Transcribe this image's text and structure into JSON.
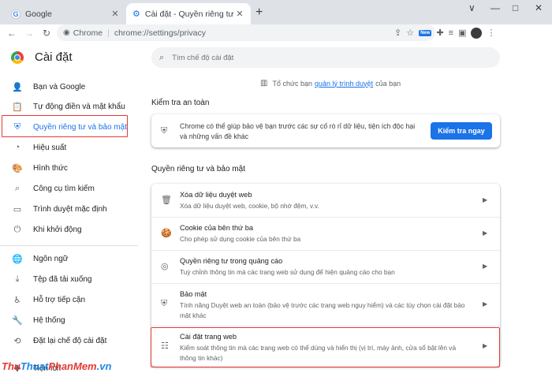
{
  "browser": {
    "tabs": [
      {
        "title": "Google",
        "icon": "google-g-icon",
        "close": "✕"
      },
      {
        "title": "Cài đặt - Quyền riêng tư và bảo mật",
        "icon": "gear-icon",
        "close": "✕"
      }
    ],
    "new_tab": "+",
    "window_controls": [
      "∨",
      "—",
      "□",
      "✕"
    ],
    "omnibox_chip": "Chrome",
    "omnibox_url": "chrome://settings/privacy",
    "extension_badge": "New"
  },
  "header": {
    "title": "Cài đặt",
    "search_placeholder": "Tìm chế độ cài đặt"
  },
  "sidebar": {
    "items": [
      {
        "label": "Bạn và Google",
        "icon": "person-icon"
      },
      {
        "label": "Tự động điền và mật khẩu",
        "icon": "clipboard-icon"
      },
      {
        "label": "Quyền riêng tư và bảo mật",
        "icon": "shield-icon",
        "active": true
      },
      {
        "label": "Hiệu suất",
        "icon": "speedometer-icon"
      },
      {
        "label": "Hình thức",
        "icon": "palette-icon"
      },
      {
        "label": "Công cụ tìm kiếm",
        "icon": "search-icon"
      },
      {
        "label": "Trình duyệt mặc định",
        "icon": "browser-window-icon"
      },
      {
        "label": "Khi khởi động",
        "icon": "power-icon"
      },
      {
        "label": "Ngôn ngữ",
        "icon": "globe-icon"
      },
      {
        "label": "Tệp đã tải xuống",
        "icon": "download-icon"
      },
      {
        "label": "Hỗ trợ tiếp cận",
        "icon": "accessibility-icon"
      },
      {
        "label": "Hệ thống",
        "icon": "wrench-icon"
      },
      {
        "label": "Đặt lại chế độ cài đặt",
        "icon": "reset-icon"
      },
      {
        "label": "Tiện ích",
        "icon": "puzzle-icon"
      }
    ]
  },
  "managed": {
    "prefix": "Tổ chức bạn",
    "link": "quản lý trình duyệt",
    "suffix": "của bạn"
  },
  "safety_check": {
    "section_title": "Kiểm tra an toàn",
    "text": "Chrome có thể giúp bảo vệ bạn trước các sự cố rò rỉ dữ liệu, tiện ích độc hại và những vấn đề khác",
    "button": "Kiểm tra ngay"
  },
  "privacy": {
    "section_title": "Quyền riêng tư và bảo mật",
    "rows": [
      {
        "title": "Xóa dữ liệu duyệt web",
        "subtitle": "Xóa dữ liệu duyệt web, cookie, bộ nhớ đệm, v.v.",
        "icon": "trash-icon"
      },
      {
        "title": "Cookie của bên thứ ba",
        "subtitle": "Cho phép sử dụng cookie của bên thứ ba",
        "icon": "cookie-icon"
      },
      {
        "title": "Quyền riêng tư trong quảng cáo",
        "subtitle": "Tuỳ chỉnh thông tin mà các trang web sử dụng để hiện quảng cáo cho bạn",
        "icon": "ads-privacy-icon"
      },
      {
        "title": "Bảo mật",
        "subtitle": "Tính năng Duyệt web an toàn (bảo vệ trước các trang web nguy hiểm) và các tùy chọn cài đặt bảo mật khác",
        "icon": "shield-icon"
      },
      {
        "title": "Cài đặt trang web",
        "subtitle": "Kiểm soát thông tin mà các trang web có thể dùng và hiển thị (vị trí, máy ảnh, cửa sổ bật lên và thông tin khác)",
        "icon": "sliders-icon"
      }
    ]
  },
  "watermark": {
    "part1": "Thu",
    "part2": "Thuat",
    "part3": "PhanMem",
    "part4": ".vn"
  }
}
